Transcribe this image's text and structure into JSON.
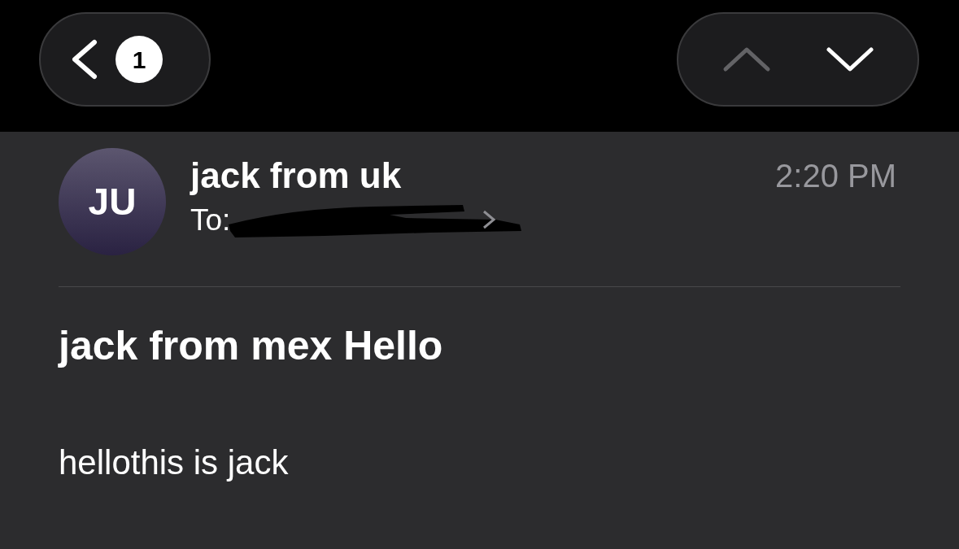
{
  "header": {
    "back_button": {
      "unread_count": "1"
    },
    "nav": [
      {
        "kind": "up",
        "disabled": true
      },
      {
        "kind": "down",
        "disabled": false
      }
    ]
  },
  "message": {
    "avatar_initials": "JU",
    "sender": "jack from uk",
    "to_label": "To:",
    "recipient_redacted": true,
    "time": "2:20 PM",
    "subject": "jack from mex Hello",
    "body": "hellothis is jack"
  }
}
